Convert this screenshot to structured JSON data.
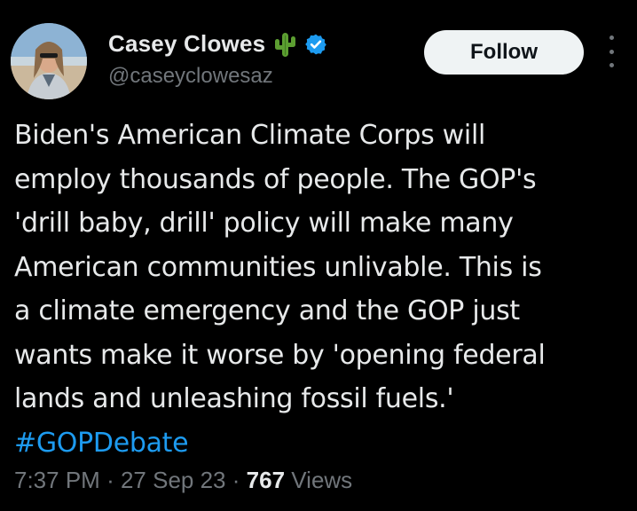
{
  "author": {
    "display_name": "Casey Clowes",
    "handle": "@caseyclowesaz",
    "name_emoji_icon": "cactus-icon",
    "verified_icon": "verified-badge-icon",
    "verified_color": "#1d9bf0"
  },
  "actions": {
    "follow_label": "Follow",
    "more_icon": "more-vertical-icon"
  },
  "tweet": {
    "lines": [
      "Biden's American Climate Corps will",
      "employ thousands of people. The GOP's",
      "'drill baby, drill' policy will make many",
      "American communities unlivable. This is",
      "a climate emergency and the GOP just",
      "wants make it worse by 'opening federal",
      "lands and unleashing fossil fuels.'"
    ],
    "hashtag": "#GOPDebate",
    "hashtag_color": "#1d9bf0"
  },
  "meta": {
    "time": "7:37 PM",
    "separator": "·",
    "date": "27 Sep 23",
    "views_count": "767",
    "views_label": "Views"
  },
  "colors": {
    "background": "#000000",
    "primary_text": "#e7e9ea",
    "secondary_text": "#71767b",
    "button_bg": "#eff3f4",
    "button_text": "#0f1419"
  }
}
